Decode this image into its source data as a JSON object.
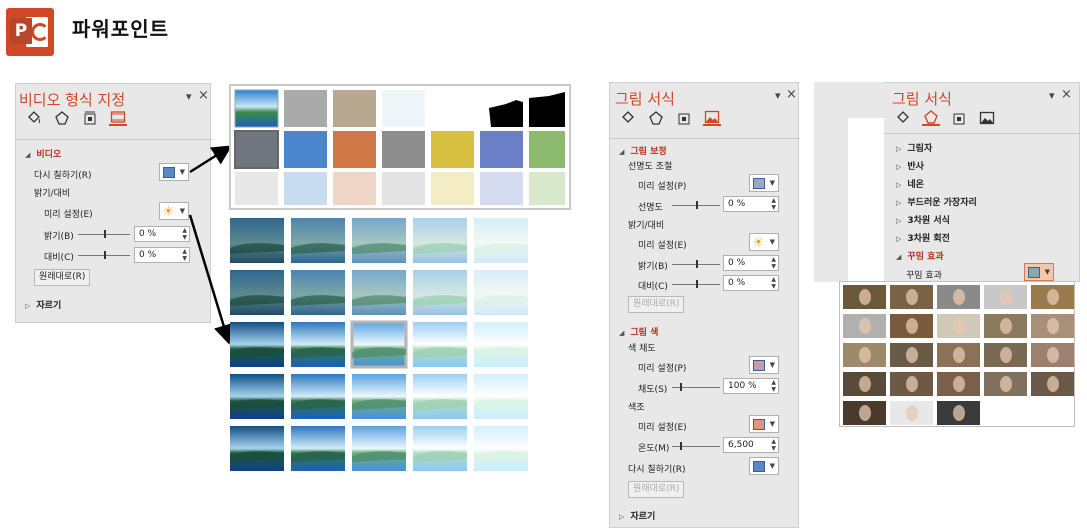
{
  "header": {
    "logo_letter": "P",
    "title": "파워포인트"
  },
  "video_pane": {
    "title": "비디오 형식 지정",
    "section_video": "비디오",
    "recolor_label": "다시 칠하기(R)",
    "brightness_contrast": "밝기/대비",
    "presets_label": "미리 설정(E)",
    "brightness_label": "밝기(B)",
    "brightness_value": "0 %",
    "contrast_label": "대비(C)",
    "contrast_value": "0 %",
    "reset_label": "원래대로(R)",
    "crop_label": "자르기"
  },
  "picture_pane": {
    "title": "그림 서식",
    "section_correction": "그림 보정",
    "sharpness_group": "선명도 조절",
    "presets_p": "미리 설정(P)",
    "sharpness_label": "선명도",
    "sharpness_value": "0 %",
    "bc_group": "밝기/대비",
    "presets_e": "미리 설정(E)",
    "brightness_label": "밝기(B)",
    "brightness_value": "0 %",
    "contrast_label": "대비(C)",
    "contrast_value": "0 %",
    "reset1": "원래대로(R)",
    "section_color": "그림 색",
    "saturation_group": "색 채도",
    "presets_p2": "미리 설정(P)",
    "saturation_label": "채도(S)",
    "saturation_value": "100 %",
    "tone_group": "색조",
    "presets_e2": "미리 설정(E)",
    "temperature_label": "온도(M)",
    "temperature_value": "6,500",
    "recolor_label": "다시 칠하기(R)",
    "reset2": "원래대로(R)",
    "crop_label": "자르기"
  },
  "effects_pane": {
    "title": "그림 서식",
    "items": [
      "그림자",
      "반사",
      "네온",
      "부드러운 가장자리",
      "3차원 서식",
      "3차원 회전"
    ],
    "artistic_section": "꾸밈 효과",
    "artistic_label": "꾸밈 효과"
  },
  "colors": {
    "accent": "#d24726",
    "pane_bg": "#e8e8e8"
  }
}
